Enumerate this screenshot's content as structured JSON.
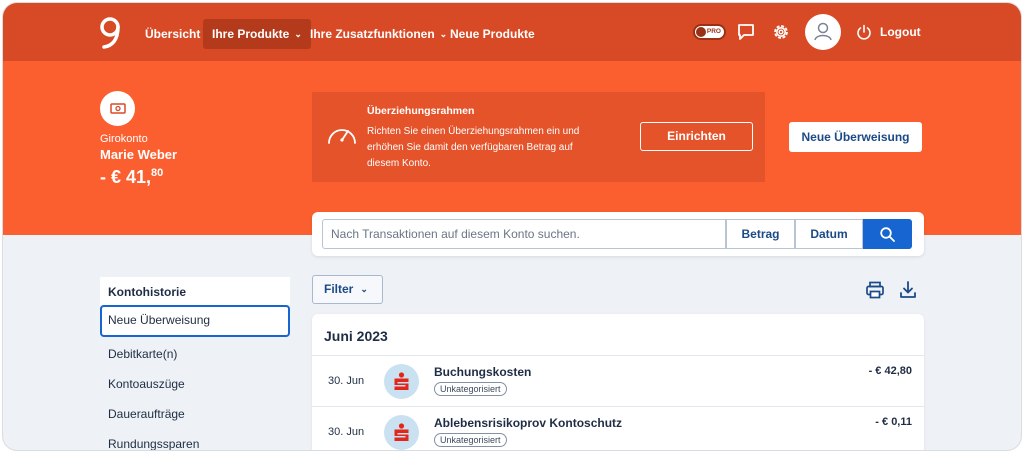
{
  "nav": {
    "items": [
      {
        "label": "Übersicht",
        "active": false,
        "dropdown": false
      },
      {
        "label": "Ihre Produkte",
        "active": true,
        "dropdown": true
      },
      {
        "label": "Ihre Zusatzfunktionen",
        "active": false,
        "dropdown": true
      },
      {
        "label": "Neue Produkte",
        "active": false,
        "dropdown": false
      }
    ],
    "pro_label": "PRO",
    "logout_label": "Logout",
    "icons": [
      "logo-icon",
      "pro-toggle",
      "chat-icon",
      "gear-icon",
      "user-icon",
      "power-icon"
    ]
  },
  "account": {
    "type": "Girokonto",
    "name": "Marie Weber",
    "balance_main": "- € 41,",
    "balance_cents": "80",
    "icon": "banknote-icon"
  },
  "overdraft": {
    "title": "Überziehungsrahmen",
    "text": "Richten Sie einen Überziehungsrahmen ein und erhöhen Sie damit den verfügbaren Betrag auf diesem Konto.",
    "button": "Einrichten",
    "icon": "gauge-icon"
  },
  "new_transfer_button": "Neue Überweisung",
  "search": {
    "placeholder": "Nach Transaktionen auf diesem Konto suchen.",
    "amount_label": "Betrag",
    "date_label": "Datum",
    "icon": "search-icon"
  },
  "sidebar": {
    "items": [
      {
        "label": "Kontohistorie"
      },
      {
        "label": "Neue Überweisung"
      },
      {
        "label": "Debitkarte(n)"
      },
      {
        "label": "Kontoauszüge"
      },
      {
        "label": "Daueraufträge"
      },
      {
        "label": "Rundungssparen"
      }
    ]
  },
  "filter_label": "Filter",
  "toolbar_icons": [
    "print-icon",
    "download-icon"
  ],
  "transactions": {
    "month": "Juni 2023",
    "rows": [
      {
        "date": "30. Jun",
        "title": "Buchungskosten",
        "tag": "Unkategorisiert",
        "amount": "- € 42,80"
      },
      {
        "date": "30. Jun",
        "title": "Ablebensrisikoprov Kontoschutz",
        "tag": "Unkategorisiert",
        "amount": "- € 0,11"
      }
    ]
  },
  "colors": {
    "nav_bg": "#d84a26",
    "hero_bg": "#fc5f2f",
    "overdraft_bg": "#e5532a",
    "accent_blue": "#1665d0",
    "text_dark": "#1f2d44"
  }
}
